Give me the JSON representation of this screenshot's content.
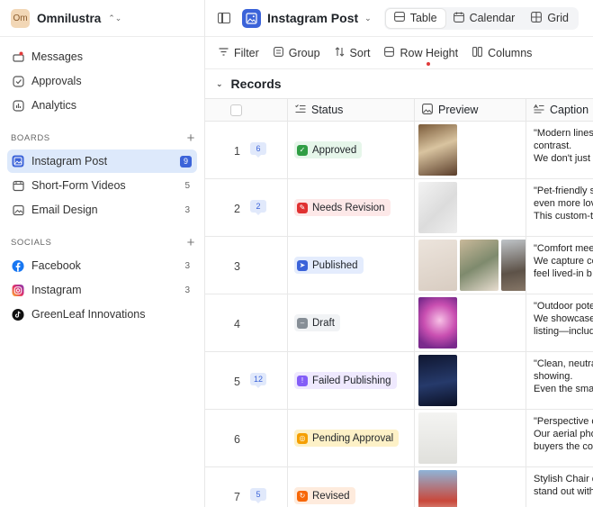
{
  "workspace": {
    "badge": "Om",
    "name": "Omnilustra"
  },
  "nav": [
    {
      "label": "Messages",
      "icon": "messages-icon"
    },
    {
      "label": "Approvals",
      "icon": "check-circle-icon"
    },
    {
      "label": "Analytics",
      "icon": "analytics-icon"
    }
  ],
  "boards": {
    "title": "BOARDS",
    "items": [
      {
        "label": "Instagram Post",
        "count": "9",
        "active": true
      },
      {
        "label": "Short-Form Videos",
        "count": "5"
      },
      {
        "label": "Email Design",
        "count": "3"
      }
    ]
  },
  "socials": {
    "title": "SOCIALS",
    "items": [
      {
        "label": "Facebook",
        "count": "3",
        "color": "#1877f2"
      },
      {
        "label": "Instagram",
        "count": "3",
        "color": "#e1306c"
      },
      {
        "label": "GreenLeaf Innovations",
        "count": "",
        "color": "#111111"
      }
    ]
  },
  "topbar": {
    "title": "Instagram Post",
    "views": [
      {
        "label": "Table",
        "active": true
      },
      {
        "label": "Calendar"
      },
      {
        "label": "Grid"
      }
    ]
  },
  "toolbar": {
    "filter": "Filter",
    "group": "Group",
    "sort": "Sort",
    "row_height": "Row Height",
    "columns": "Columns"
  },
  "records_title": "Records",
  "columns": {
    "status": "Status",
    "preview": "Preview",
    "caption": "Caption"
  },
  "rows": [
    {
      "num": "1",
      "comments": "6",
      "status": "Approved",
      "caption": [
        "\"Modern lines",
        "contrast.",
        "We don't just"
      ]
    },
    {
      "num": "2",
      "comments": "2",
      "status": "Needs Revision",
      "caption": [
        "\"Pet-friendly s",
        "even more lov",
        "This custom-t"
      ]
    },
    {
      "num": "3",
      "comments": "",
      "status": "Published",
      "caption": [
        "\"Comfort mee",
        "We capture co",
        "feel lived-in b"
      ]
    },
    {
      "num": "4",
      "comments": "",
      "status": "Draft",
      "caption": [
        "\"Outdoor pote",
        "We showcase",
        "listing—includ"
      ]
    },
    {
      "num": "5",
      "comments": "12",
      "status": "Failed Publishing",
      "caption": [
        "\"Clean, neutra",
        "showing.",
        "Even the smal"
      ]
    },
    {
      "num": "6",
      "comments": "",
      "status": "Pending Approval",
      "caption": [
        "\"Perspective c",
        "Our aerial pho",
        "buyers the co"
      ]
    },
    {
      "num": "7",
      "comments": "5",
      "status": "Revised",
      "caption": [
        "Stylish Chair c",
        "stand out with"
      ]
    }
  ],
  "status_colors": {
    "Approved": "#2f9e44",
    "Needs Revision": "#e03131",
    "Published": "#3b63d9",
    "Draft": "#868e96",
    "Failed Publishing": "#845ef7",
    "Pending Approval": "#f59f00",
    "Revised": "#f76707"
  }
}
